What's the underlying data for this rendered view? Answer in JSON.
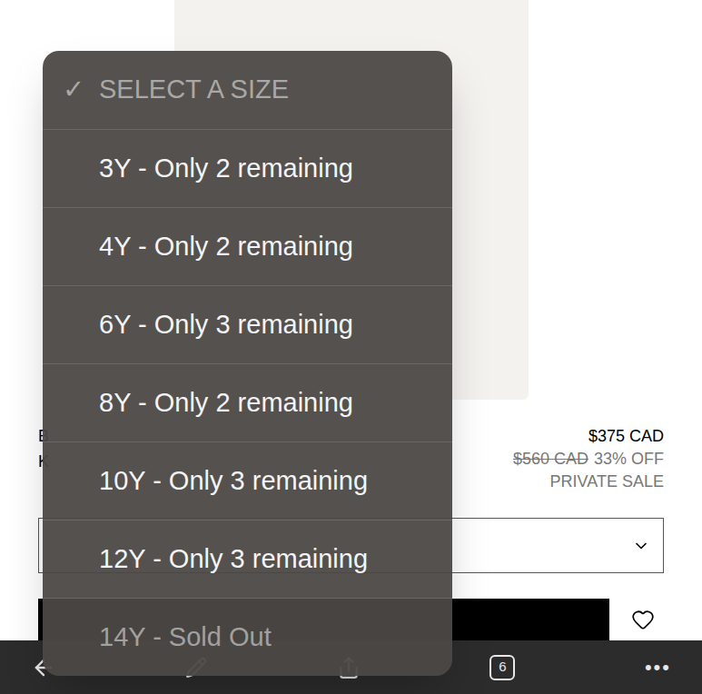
{
  "product": {
    "brand": "B",
    "name": "K",
    "price": "$375 CAD",
    "original_price": "$560 CAD",
    "discount": "33% OFF",
    "sale_label": "PRIVATE SALE"
  },
  "size_select": {
    "expanded": true
  },
  "size_menu": {
    "header": {
      "check": "✓",
      "label": "SELECT A SIZE",
      "selected": true
    },
    "options": [
      {
        "label": "3Y - Only 2 remaining",
        "selected": false,
        "disabled": false
      },
      {
        "label": "4Y - Only 2 remaining",
        "selected": false,
        "disabled": false
      },
      {
        "label": "6Y - Only 3 remaining",
        "selected": false,
        "disabled": false
      },
      {
        "label": "8Y - Only 2 remaining",
        "selected": false,
        "disabled": false
      },
      {
        "label": "10Y - Only 3 remaining",
        "selected": false,
        "disabled": false
      },
      {
        "label": "12Y - Only 3 remaining",
        "selected": false,
        "disabled": false
      },
      {
        "label": "14Y - Sold Out",
        "selected": false,
        "disabled": true
      }
    ]
  },
  "toolbar": {
    "tab_count": "6",
    "more": "•••"
  }
}
